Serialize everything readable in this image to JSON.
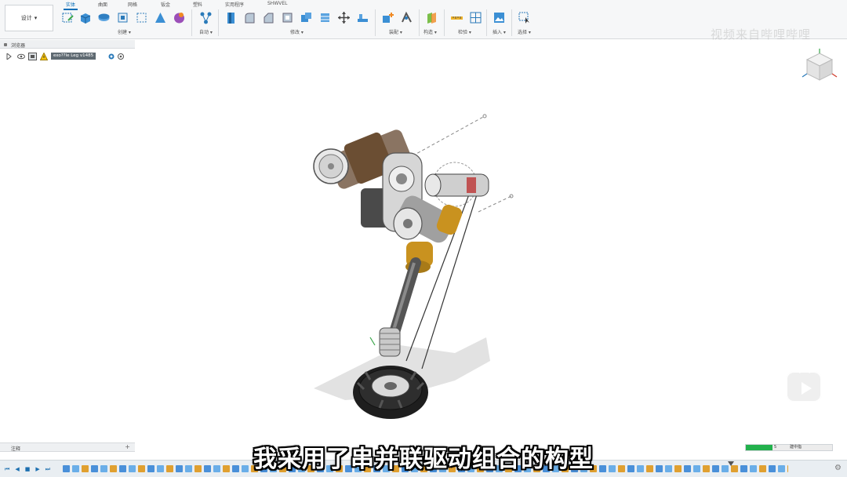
{
  "ribbon": {
    "workspace_label": "设计",
    "tabs": [
      {
        "label": "实体",
        "active": true
      },
      {
        "label": "曲面"
      },
      {
        "label": "网格"
      },
      {
        "label": "钣金"
      },
      {
        "label": "塑料"
      },
      {
        "label": "实用程序"
      },
      {
        "label": "SHWVEL"
      }
    ],
    "groups": [
      {
        "label": "创建 ▾"
      },
      {
        "label": "自动 ▾"
      },
      {
        "label": "修改 ▾"
      },
      {
        "label": "装配 ▾"
      },
      {
        "label": "构造 ▾"
      },
      {
        "label": "检验 ▾"
      },
      {
        "label": "插入 ▾"
      },
      {
        "label": "选择 ▾"
      }
    ]
  },
  "browser": {
    "title": "浏览器",
    "document_name": "exo??le Leg v1485"
  },
  "viewport": {
    "watermark": "视频来自哔哩哔哩"
  },
  "comments": {
    "title": "注释"
  },
  "status": {
    "value": "5",
    "text": "建中指"
  },
  "timeline": {
    "controls": [
      "⏮",
      "◀",
      "■",
      "▶",
      "⏭"
    ],
    "settings_icon": "⚙"
  },
  "subtitle": "我采用了串并联驱动组合的构型",
  "colors": {
    "accent": "#0a6fb8",
    "status_green": "#22b14c",
    "gold": "#c9921f"
  }
}
